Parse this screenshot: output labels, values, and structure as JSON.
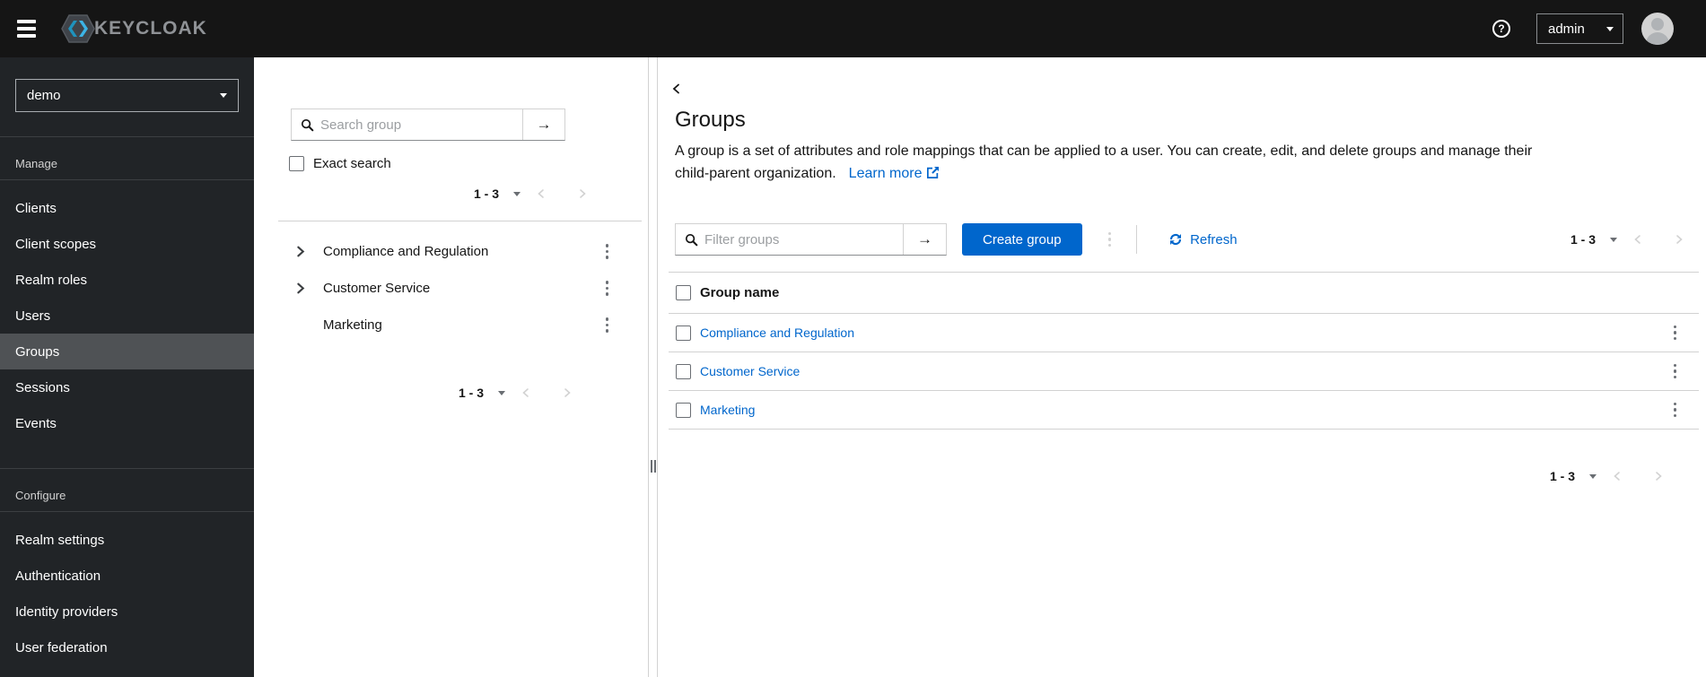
{
  "topbar": {
    "brand": "KEYCLOAK",
    "username": "admin",
    "help_glyph": "?"
  },
  "sidebar": {
    "realm_selector": "demo",
    "sections": [
      {
        "label": "Manage",
        "items": [
          {
            "label": "Clients",
            "selected": false
          },
          {
            "label": "Client scopes",
            "selected": false
          },
          {
            "label": "Realm roles",
            "selected": false
          },
          {
            "label": "Users",
            "selected": false
          },
          {
            "label": "Groups",
            "selected": true
          },
          {
            "label": "Sessions",
            "selected": false
          },
          {
            "label": "Events",
            "selected": false
          }
        ]
      },
      {
        "label": "Configure",
        "items": [
          {
            "label": "Realm settings",
            "selected": false
          },
          {
            "label": "Authentication",
            "selected": false
          },
          {
            "label": "Identity providers",
            "selected": false
          },
          {
            "label": "User federation",
            "selected": false
          }
        ]
      }
    ]
  },
  "drawer": {
    "search_placeholder": "Search group",
    "exact_search_label": "Exact search",
    "pagination_top": {
      "range": "1 - 3"
    },
    "pagination_bottom": {
      "range": "1 - 3"
    },
    "groups": [
      {
        "label": "Compliance and Regulation",
        "expandable": true
      },
      {
        "label": "Customer Service",
        "expandable": true
      },
      {
        "label": "Marketing",
        "expandable": false
      }
    ]
  },
  "main": {
    "title": "Groups",
    "description_line1": "A group is a set of attributes and role mappings that can be applied to a user. You can create, edit, and delete groups and manage their",
    "description_line2": "child-parent organization.",
    "learn_more_label": "Learn more",
    "filter_placeholder": "Filter groups",
    "create_button_label": "Create group",
    "refresh_label": "Refresh",
    "pagination_top": {
      "range": "1 - 3"
    },
    "pagination_bottom": {
      "range": "1 - 3"
    },
    "table": {
      "header": "Group name",
      "rows": [
        {
          "name": "Compliance and Regulation"
        },
        {
          "name": "Customer Service"
        },
        {
          "name": "Marketing"
        }
      ]
    }
  },
  "icons": {
    "submit_arrow": "→"
  },
  "colors": {
    "accent": "#0066cc",
    "topbar_bg": "#151515",
    "sidebar_bg": "#212427",
    "sidebar_selected_bg": "#4f5255",
    "link": "#0066cc",
    "border": "#d2d2d2"
  }
}
